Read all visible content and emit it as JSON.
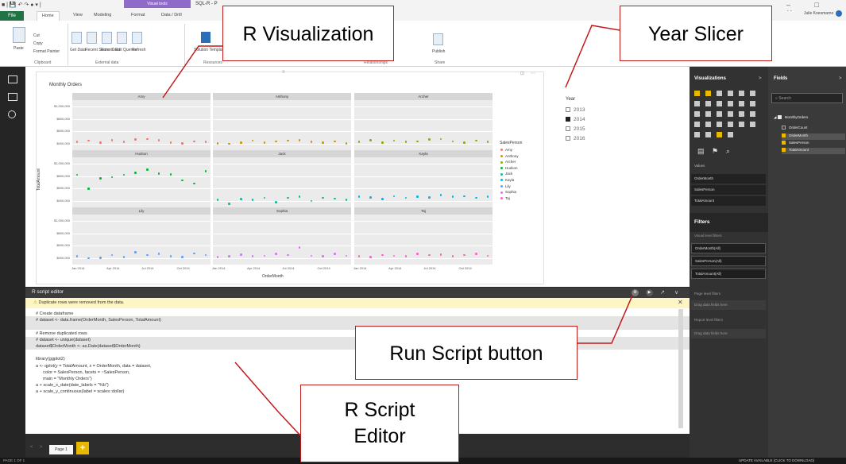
{
  "window": {
    "quick_access": "■ | 💾 ↶ ↷ ● ▾ |",
    "context_tab": "Visual tools",
    "document_title": "SQL-R - P",
    "controls": "– □ ✕",
    "user_name": "Julie Koesmarno"
  },
  "ribbon": {
    "file_tab": "File",
    "tabs": [
      "Home",
      "View",
      "Modeling",
      "Format",
      "Data / Drill"
    ],
    "clipboard": {
      "paste": "Paste",
      "cut": "Cut",
      "copy": "Copy",
      "format_painter": "Format Painter",
      "group": "Clipboard"
    },
    "external_data": {
      "get_data": "Get Data",
      "recent_sources": "Recent Sources",
      "enter_data": "Enter Data",
      "edit_queries": "Edit Queries",
      "refresh": "Refresh",
      "group": "External data"
    },
    "solution_templates": "Solution Templates",
    "resources_group": "Resources",
    "relationships_group": "Relationships",
    "publish": "Publish",
    "share_group": "Share"
  },
  "chart_data": {
    "type": "scatter",
    "title": "Monthly Orders",
    "xlabel": "OrderMonth",
    "ylabel": "TotalAmount",
    "x_ticks": [
      "Jan 2014",
      "Apr 2014",
      "Jul 2014",
      "Oct 2014"
    ],
    "y_ticks": [
      "$1,000,000",
      "$800,000",
      "$600,000",
      "$400,000"
    ],
    "ylim": [
      300000,
      1100000
    ],
    "x_months": [
      1,
      2,
      3,
      4,
      5,
      6,
      7,
      8,
      9,
      10,
      11,
      12
    ],
    "grid": true,
    "legend_title": "SalesPerson",
    "legend_placement": "right",
    "facets": [
      {
        "name": "Amy",
        "color": "#f8766d",
        "values": [
          430000,
          450000,
          420000,
          460000,
          430000,
          470000,
          480000,
          460000,
          420000,
          410000,
          440000,
          430000
        ]
      },
      {
        "name": "Anthony",
        "color": "#d39200",
        "values": [
          410000,
          400000,
          420000,
          450000,
          420000,
          440000,
          450000,
          460000,
          430000,
          420000,
          440000,
          410000
        ]
      },
      {
        "name": "Archer",
        "color": "#93aa00",
        "values": [
          430000,
          460000,
          420000,
          450000,
          430000,
          440000,
          470000,
          480000,
          440000,
          420000,
          450000,
          430000
        ]
      },
      {
        "name": "Hudson",
        "color": "#00ba38",
        "values": [
          820000,
          600000,
          760000,
          780000,
          820000,
          850000,
          900000,
          840000,
          830000,
          730000,
          680000,
          880000
        ]
      },
      {
        "name": "Jack",
        "color": "#00c19f",
        "values": [
          420000,
          360000,
          430000,
          420000,
          450000,
          380000,
          450000,
          470000,
          400000,
          450000,
          440000,
          420000
        ]
      },
      {
        "name": "Kayla",
        "color": "#00b9e3",
        "values": [
          470000,
          460000,
          430000,
          480000,
          450000,
          470000,
          460000,
          500000,
          470000,
          480000,
          450000,
          470000
        ]
      },
      {
        "name": "Lily",
        "color": "#619cff",
        "values": [
          430000,
          400000,
          410000,
          450000,
          420000,
          500000,
          450000,
          470000,
          430000,
          420000,
          480000,
          450000
        ]
      },
      {
        "name": "Sophia",
        "color": "#db72fb",
        "values": [
          420000,
          430000,
          460000,
          430000,
          440000,
          470000,
          450000,
          570000,
          440000,
          430000,
          470000,
          440000
        ]
      },
      {
        "name": "Taj",
        "color": "#ff61c3",
        "values": [
          430000,
          420000,
          450000,
          440000,
          430000,
          470000,
          450000,
          460000,
          430000,
          450000,
          470000,
          440000
        ]
      }
    ]
  },
  "slicer": {
    "title": "Year",
    "items": [
      {
        "label": "2013",
        "checked": false
      },
      {
        "label": "2014",
        "checked": true
      },
      {
        "label": "2015",
        "checked": false
      },
      {
        "label": "2016",
        "checked": false
      }
    ]
  },
  "editor": {
    "title": "R script editor",
    "run_icon": "▶",
    "settings_icon": "⚙",
    "expand_icon": "↗",
    "collapse_icon": "∨",
    "warning": "Duplicate rows were removed from the data.",
    "close_icon": "✕",
    "code": [
      "# Create dataframe",
      "# dataset <- data.frame(OrderMonth, SalesPerson, TotalAmount)",
      "",
      "# Remove duplicated rows",
      "# dataset <- unique(dataset)",
      "dataset$OrderMonth <- as.Date(dataset$OrderMonth)",
      "",
      "library(ggplot2)",
      "a <- qplot(y = TotalAmount, x = OrderMonth, data = dataset,",
      "      color = SalesPerson, facets = ~SalesPerson,",
      "      main = \"Monthly Orders\")",
      "a + scale_x_date(date_labels = \"%b\")",
      "a + scale_y_continuous(label = scales::dollar)"
    ]
  },
  "pages": {
    "tab": "Page 1",
    "add": "+",
    "prev": "<",
    "next": ">"
  },
  "status": {
    "page": "PAGE 1 OF 1",
    "update": "UPDATE AVAILABLE (CLICK TO DOWNLOAD)"
  },
  "visualizations": {
    "title": "Visualizations",
    "chevron": ">",
    "values_label": "Values",
    "wells": [
      "OrderMonth",
      "SalesPerson",
      "TotalAmount"
    ],
    "filters_title": "Filters",
    "visual_level": "Visual level filters",
    "filters": [
      "OrderMonth(All)",
      "SalesPerson(All)",
      "TotalAmount(All)"
    ],
    "page_level": "Page level filters",
    "drag_here": "Drag data fields here",
    "report_level": "Report level filters",
    "drag_here2": "Drag data fields here"
  },
  "fields": {
    "title": "Fields",
    "chevron": ">",
    "search_placeholder": "Search",
    "table": "MonthlyOrders",
    "items": [
      {
        "label": "OrderCount",
        "checked": false
      },
      {
        "label": "OrderMonth",
        "checked": true
      },
      {
        "label": "SalesPerson",
        "checked": true
      },
      {
        "label": "TotalAmount",
        "checked": true
      }
    ]
  },
  "callouts": {
    "r_visualization": "R Visualization",
    "year_slicer": "Year Slicer",
    "run_script": "Run Script button",
    "r_script_editor_1": "R Script",
    "r_script_editor_2": "Editor"
  }
}
